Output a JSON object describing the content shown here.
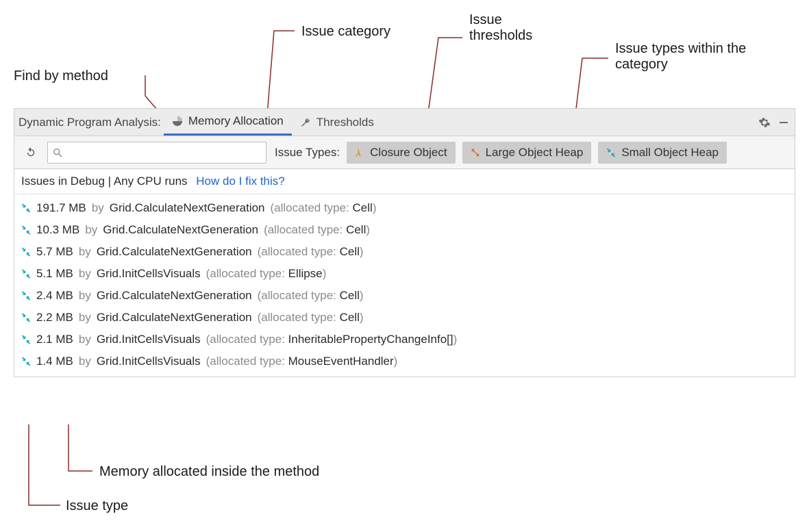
{
  "annotations": {
    "find_by_method": "Find by method",
    "issue_category": "Issue category",
    "issue_thresholds": "Issue thresholds",
    "issue_types_within": "Issue types within the category",
    "memory_allocated": "Memory allocated inside the method",
    "issue_type": "Issue type"
  },
  "tabs": {
    "title": "Dynamic Program Analysis:",
    "memory_allocation": "Memory Allocation",
    "thresholds": "Thresholds"
  },
  "filters": {
    "search_placeholder": "",
    "issue_types_label": "Issue Types:",
    "chip_closure": "Closure Object",
    "chip_loh": "Large Object Heap",
    "chip_soh": "Small Object Heap"
  },
  "header": {
    "text": "Issues in Debug | Any CPU runs",
    "link": "How do I fix this?"
  },
  "rows": [
    {
      "size": "191.7 MB",
      "by": "by",
      "method": "Grid.CalculateNextGeneration",
      "alloc_prefix": "(allocated type:",
      "alloc_type": "Cell",
      "alloc_suffix": ")"
    },
    {
      "size": "10.3 MB",
      "by": "by",
      "method": "Grid.CalculateNextGeneration",
      "alloc_prefix": "(allocated type:",
      "alloc_type": "Cell",
      "alloc_suffix": ")"
    },
    {
      "size": "5.7 MB",
      "by": "by",
      "method": "Grid.CalculateNextGeneration",
      "alloc_prefix": "(allocated type:",
      "alloc_type": "Cell",
      "alloc_suffix": ")"
    },
    {
      "size": "5.1 MB",
      "by": "by",
      "method": "Grid.InitCellsVisuals",
      "alloc_prefix": "(allocated type:",
      "alloc_type": "Ellipse",
      "alloc_suffix": ")"
    },
    {
      "size": "2.4 MB",
      "by": "by",
      "method": "Grid.CalculateNextGeneration",
      "alloc_prefix": "(allocated type:",
      "alloc_type": "Cell",
      "alloc_suffix": ")"
    },
    {
      "size": "2.2 MB",
      "by": "by",
      "method": "Grid.CalculateNextGeneration",
      "alloc_prefix": "(allocated type:",
      "alloc_type": "Cell",
      "alloc_suffix": ")"
    },
    {
      "size": "2.1 MB",
      "by": "by",
      "method": "Grid.InitCellsVisuals",
      "alloc_prefix": "(allocated type:",
      "alloc_type": "InheritablePropertyChangeInfo[]",
      "alloc_suffix": ")"
    },
    {
      "size": "1.4 MB",
      "by": "by",
      "method": "Grid.InitCellsVisuals",
      "alloc_prefix": "(allocated type:",
      "alloc_type": "MouseEventHandler",
      "alloc_suffix": ")"
    }
  ]
}
